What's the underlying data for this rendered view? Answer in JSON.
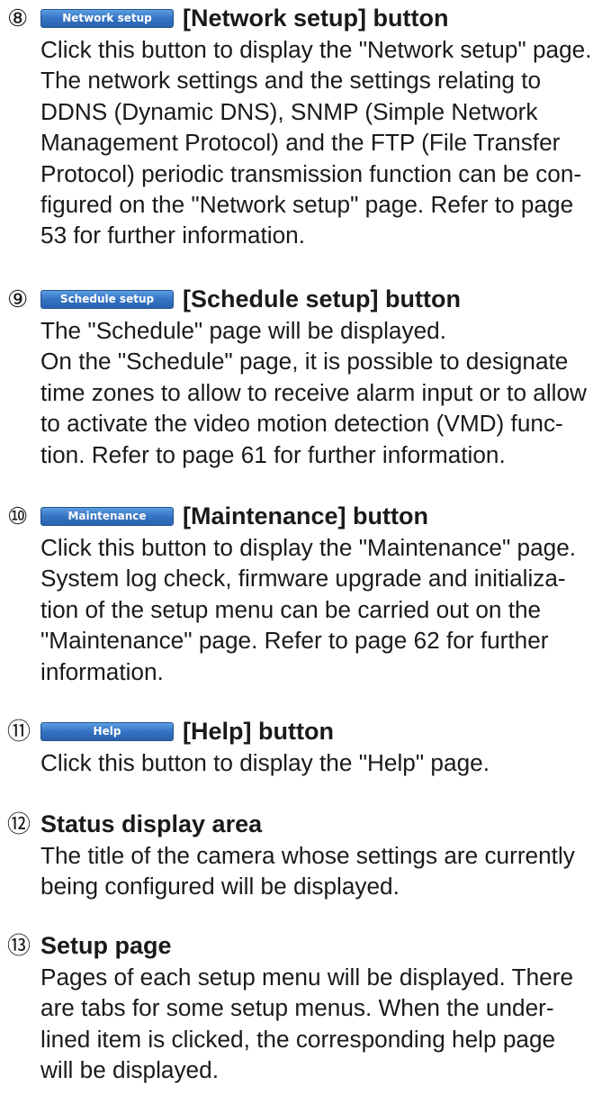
{
  "items": [
    {
      "number": "⑧",
      "button_label": "Network setup",
      "caption": "[Network setup] button",
      "body_lines": [
        "Click this button to display the \"Network setup\" page.",
        "The network settings and the settings relating to",
        "DDNS (Dynamic DNS), SNMP (Simple Network",
        "Management Protocol) and the FTP (File Transfer",
        "Protocol) periodic transmission function can be con-",
        "figured on the \"Network setup\" page. Refer to page",
        "53 for further information."
      ]
    },
    {
      "number": "⑨",
      "button_label": "Schedule setup",
      "caption": "[Schedule setup] button",
      "body_lines": [
        "The \"Schedule\" page will be displayed.",
        "On the \"Schedule\" page, it is possible to designate",
        "time zones to allow to receive alarm input or to allow",
        "to activate the video motion detection (VMD) func-",
        "tion. Refer to page 61 for further information."
      ]
    },
    {
      "number": "⑩",
      "button_label": "Maintenance",
      "caption": "[Maintenance] button",
      "body_lines": [
        "Click this button to display the \"Maintenance\" page.",
        "System log check, firmware upgrade and initializa-",
        "tion of the setup menu can be carried out on the",
        "\"Maintenance\" page. Refer to page 62 for further",
        "information."
      ]
    },
    {
      "number": "⑪",
      "button_label": "Help",
      "caption": "[Help] button",
      "body_lines": [
        "Click this button to display the \"Help\" page."
      ]
    },
    {
      "number": "⑫",
      "title": "Status display area",
      "body_lines": [
        "The title of the camera whose settings are currently",
        "being configured will be displayed."
      ]
    },
    {
      "number": "⑬",
      "title": "Setup page",
      "body_lines": [
        "Pages of each setup menu will be displayed. There",
        "are tabs for some setup menus. When the under-",
        "lined item is clicked, the corresponding help page",
        "will be displayed."
      ]
    }
  ]
}
